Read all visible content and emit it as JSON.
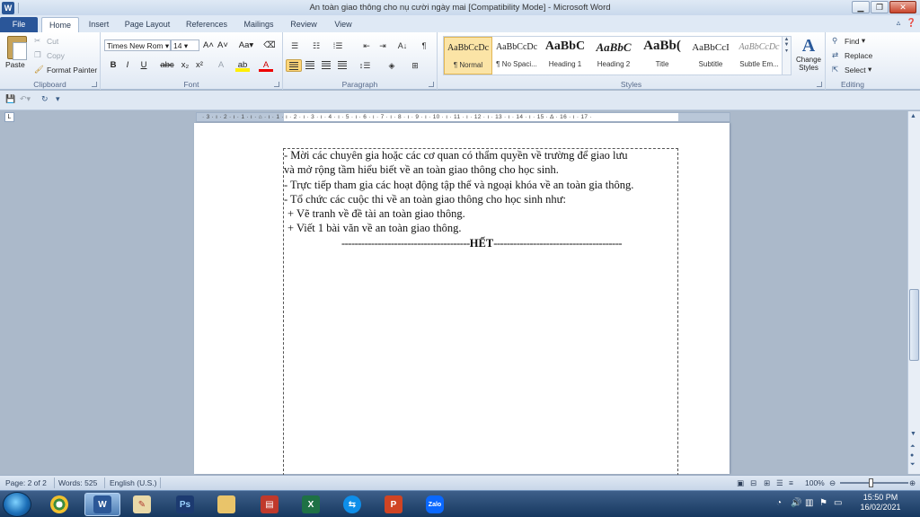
{
  "window": {
    "title": "An toàn giao thông cho nụ cười ngày mai [Compatibility Mode] - Microsoft Word",
    "app_logo": "W"
  },
  "tabs": [
    "File",
    "Home",
    "Insert",
    "Page Layout",
    "References",
    "Mailings",
    "Review",
    "View"
  ],
  "ribbon": {
    "clipboard": {
      "paste": "Paste",
      "cut": "Cut",
      "copy": "Copy",
      "format_painter": "Format Painter",
      "label": "Clipboard"
    },
    "font": {
      "family": "Times New Rom",
      "size": "14",
      "label": "Font"
    },
    "paragraph": {
      "label": "Paragraph"
    },
    "styles": {
      "label": "Styles",
      "items": [
        {
          "sample": "AaBbCcDc",
          "name": "¶ Normal"
        },
        {
          "sample": "AaBbCcDc",
          "name": "¶ No Spaci..."
        },
        {
          "sample": "AaBbC",
          "name": "Heading 1"
        },
        {
          "sample": "AaBbC",
          "name": "Heading 2"
        },
        {
          "sample": "AaBb(",
          "name": "Title"
        },
        {
          "sample": "AaBbCcI",
          "name": "Subtitle"
        },
        {
          "sample": "AaBbCcDc",
          "name": "Subtle Em..."
        }
      ],
      "change_styles": "Change Styles"
    },
    "editing": {
      "find": "Find",
      "replace": "Replace",
      "select": "Select",
      "label": "Editing"
    }
  },
  "ruler": {
    "marks": "· 3 · ı · 2 · ı · 1 · ı · ⌂ · ı · 1 · ı · 2 · ı · 3 · ı · 4 · ı · 5 · ı · 6 · ı · 7 · ı · 8 · ı · 9 · ı · 10 · ı · 11 · ı · 12 · ı · 13 · ı · 14 · ı · 15 · ∆ · 16 · ı · 17 ·"
  },
  "document": {
    "lines": [
      "- Mời các chuyên gia hoặc các cơ quan có thẩm quyền về trường để giao lưu",
      "và mở rộng tầm hiểu biết về an toàn giao thông cho học sinh.",
      "- Trực tiếp tham gia các hoạt động tập thể và ngoại khóa về an toàn gia thông.",
      "- Tổ chức các cuộc thi về an toàn giao thông cho học sinh như:",
      "+ Vẽ tranh về đề tài an toàn giao thông.",
      "+ Viết 1 bài văn về an toàn giao thông."
    ],
    "end_left": "---------------------------------------",
    "end_word": "HẾT",
    "end_right": "---------------------------------------"
  },
  "statusbar": {
    "page": "Page: 2 of 2",
    "words": "Words: 525",
    "language": "English (U.S.)",
    "zoom": "100%"
  },
  "taskbar": {
    "time": "15:50 PM",
    "date": "16/02/2021",
    "apps": [
      "chrome",
      "word",
      "paint",
      "photoshop",
      "explorer",
      "app",
      "excel",
      "teamviewer",
      "powerpoint",
      "zalo"
    ],
    "zalo_label": "Zalo"
  }
}
